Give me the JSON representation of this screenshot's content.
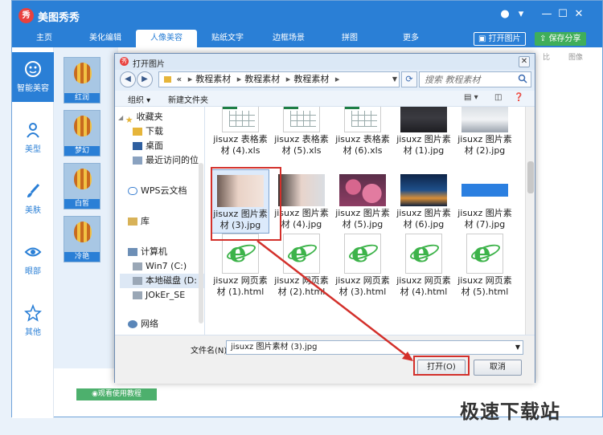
{
  "app": {
    "logo_glyph": "秀",
    "name": "美图秀秀",
    "nav_tabs": [
      {
        "label": "主页"
      },
      {
        "label": "美化编辑"
      },
      {
        "label": "人像美容"
      },
      {
        "label": "贴纸文字"
      },
      {
        "label": "边框场景"
      },
      {
        "label": "拼图"
      },
      {
        "label": "更多"
      }
    ],
    "active_tab": "人像美容",
    "open_image_btn": "打开图片",
    "save_share_btn": "保存分享",
    "window_controls": {
      "menu": "▾",
      "min": "—",
      "max": "☐",
      "close": "✕"
    }
  },
  "left_panel": [
    {
      "label": "智能美容",
      "icon": "face-icon"
    },
    {
      "label": "美型",
      "icon": "person-icon"
    },
    {
      "label": "美肤",
      "icon": "brush-icon"
    },
    {
      "label": "眼部",
      "icon": "eye-icon"
    },
    {
      "label": "其他",
      "icon": "star-icon"
    }
  ],
  "thumbs": [
    {
      "label": "红润"
    },
    {
      "label": "梦幻"
    },
    {
      "label": "白皙"
    },
    {
      "label": "冷艳"
    }
  ],
  "tutorial_btn": "观看使用教程",
  "right_labels": [
    "比",
    "图像"
  ],
  "dialog": {
    "title": "打开图片",
    "close": "✕",
    "breadcrumb": [
      "«",
      "教程素材",
      "教程素材",
      "教程素材"
    ],
    "search_placeholder": "搜索 教程素材",
    "toolbar": {
      "organize": "组织 ▾",
      "new_folder": "新建文件夹"
    },
    "tree": [
      {
        "label": "收藏夹",
        "type": "star"
      },
      {
        "label": "下载",
        "type": "folder"
      },
      {
        "label": "桌面",
        "type": "desktop"
      },
      {
        "label": "最近访问的位",
        "type": "recent"
      },
      {
        "label": "WPS云文档",
        "type": "cloud"
      },
      {
        "label": "库",
        "type": "library"
      },
      {
        "label": "计算机",
        "type": "computer"
      },
      {
        "label": "Win7 (C:)",
        "type": "drive"
      },
      {
        "label": "本地磁盘 (D:",
        "type": "drive"
      },
      {
        "label": "JOkEr_SE",
        "type": "drive"
      },
      {
        "label": "网络",
        "type": "network"
      }
    ],
    "files": [
      {
        "name": "jisuxz 表格素材 (4).xls",
        "kind": "xls"
      },
      {
        "name": "jisuxz 表格素材 (5).xls",
        "kind": "xls"
      },
      {
        "name": "jisuxz 表格素材 (6).xls",
        "kind": "xls"
      },
      {
        "name": "jisuxz 图片素材 (1).jpg",
        "kind": "car1"
      },
      {
        "name": "jisuxz 图片素材 (2).jpg",
        "kind": "car2"
      },
      {
        "name": "jisuxz 图片素材 (3).jpg",
        "kind": "girl1"
      },
      {
        "name": "jisuxz 图片素材 (4).jpg",
        "kind": "girl2"
      },
      {
        "name": "jisuxz 图片素材 (5).jpg",
        "kind": "flowers"
      },
      {
        "name": "jisuxz 图片素材 (6).jpg",
        "kind": "city"
      },
      {
        "name": "jisuxz 图片素材 (7).jpg",
        "kind": "web"
      },
      {
        "name": "jisuxz 网页素材 (1).html",
        "kind": "html"
      },
      {
        "name": "jisuxz 网页素材 (2).html",
        "kind": "html"
      },
      {
        "name": "jisuxz 网页素材 (3).html",
        "kind": "html"
      },
      {
        "name": "jisuxz 网页素材 (4).html",
        "kind": "html"
      },
      {
        "name": "jisuxz 网页素材 (5).html",
        "kind": "html"
      }
    ],
    "filename_label": "文件名(N):",
    "filename_value": "jisuxz 图片素材 (3).jpg",
    "open_btn": "打开(O)",
    "cancel_btn": "取消"
  },
  "watermark": "极速下载站",
  "colors": {
    "brand": "#2a7fd6",
    "highlight": "#d3302b",
    "accent_green": "#4db06d"
  }
}
